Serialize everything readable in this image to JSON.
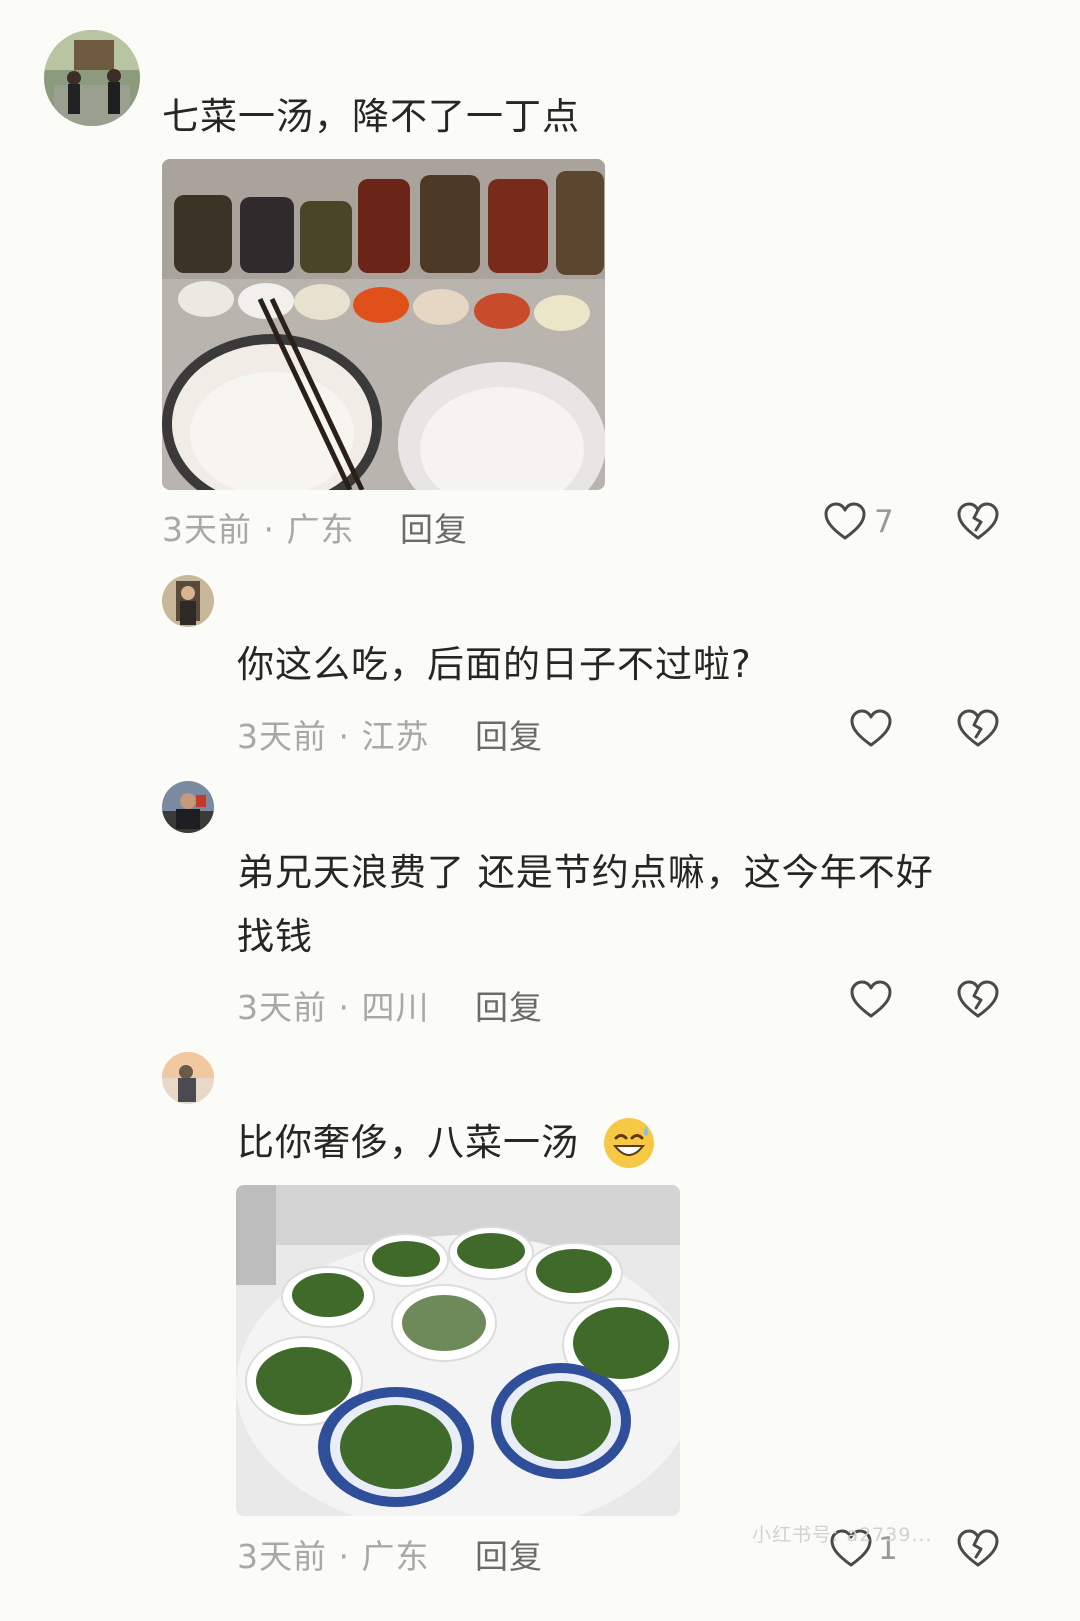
{
  "comments": [
    {
      "text": "七菜一汤，降不了一丁点",
      "meta": "3天前 · 广东",
      "reply": "回复",
      "likes": "7",
      "avatar_icon": "user-avatar-photo",
      "image_desc_icon": "food-photo-icon"
    },
    {
      "text": "你这么吃，后面的日子不过啦?",
      "meta": "3天前 · 江苏",
      "reply": "回复",
      "likes": "",
      "avatar_icon": "user-avatar-photo"
    },
    {
      "text_line1": "弟兄天浪费了  还是节约点嘛，这今年不好",
      "text_line2": "找钱",
      "meta": "3天前 · 四川",
      "reply": "回复",
      "likes": "",
      "avatar_icon": "user-avatar-photo"
    },
    {
      "text": "比你奢侈，八菜一汤",
      "emoji": "😅",
      "meta": "3天前 · 广东",
      "reply": "回复",
      "likes": "1",
      "avatar_icon": "user-avatar-photo"
    }
  ],
  "icons": {
    "like": "heart-outline-icon",
    "dislike": "broken-heart-icon"
  },
  "watermark": "小红书号: a2739..."
}
